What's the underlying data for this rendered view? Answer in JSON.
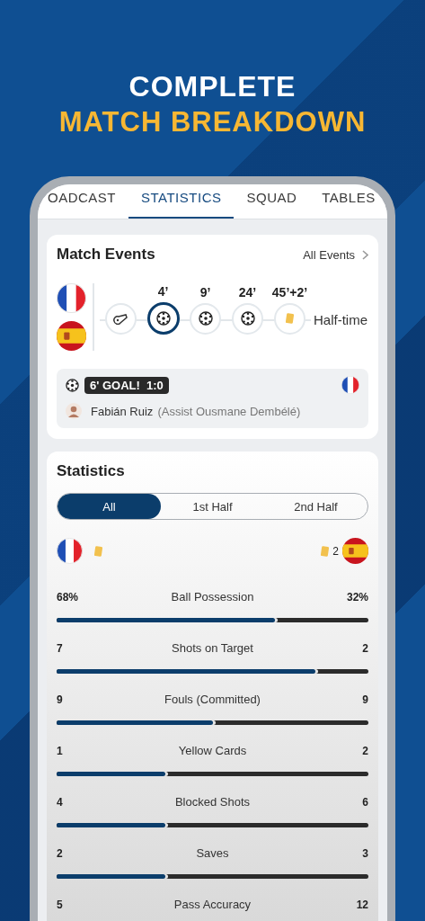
{
  "headline": {
    "line1": "COMPLETE",
    "line2": "MATCH BREAKDOWN"
  },
  "tabs": [
    {
      "label": "OADCAST",
      "selected": false
    },
    {
      "label": "STATISTICS",
      "selected": true
    },
    {
      "label": "SQUAD",
      "selected": false
    },
    {
      "label": "TABLES",
      "selected": false
    }
  ],
  "match_events": {
    "title": "Match Events",
    "link": "All Events",
    "timeline": [
      {
        "kind": "whistle",
        "selected": false
      },
      {
        "kind": "goal",
        "minute": "4’",
        "selected": true
      },
      {
        "kind": "goal",
        "minute": "9’",
        "selected": false
      },
      {
        "kind": "goal",
        "minute": "24’",
        "selected": false
      },
      {
        "kind": "card",
        "minute": "45’+2’",
        "selected": false
      }
    ],
    "end_label": "Half-time",
    "event": {
      "badge": "6' GOAL!  1:0",
      "player": "Fabián Ruiz",
      "assist": "(Assist Ousmane Dembélé)"
    }
  },
  "statistics": {
    "title": "Statistics",
    "filters": [
      {
        "label": "All",
        "selected": true
      },
      {
        "label": "1st Half",
        "selected": false
      },
      {
        "label": "2nd Half",
        "selected": false
      }
    ],
    "away_cards": "2",
    "rows": [
      {
        "home": "68%",
        "label": "Ball Possession",
        "away": "32%",
        "level": 0.7
      },
      {
        "home": "7",
        "label": "Shots on Target",
        "away": "2",
        "level": 0.83
      },
      {
        "home": "9",
        "label": "Fouls (Committed)",
        "away": "9",
        "level": 0.5
      },
      {
        "home": "1",
        "label": "Yellow Cards",
        "away": "2",
        "level": 0.35
      },
      {
        "home": "4",
        "label": "Blocked Shots",
        "away": "6",
        "level": 0.35
      },
      {
        "home": "2",
        "label": "Saves",
        "away": "3",
        "level": 0.35
      },
      {
        "home": "5",
        "label": "Pass Accuracy",
        "away": "12"
      }
    ]
  }
}
